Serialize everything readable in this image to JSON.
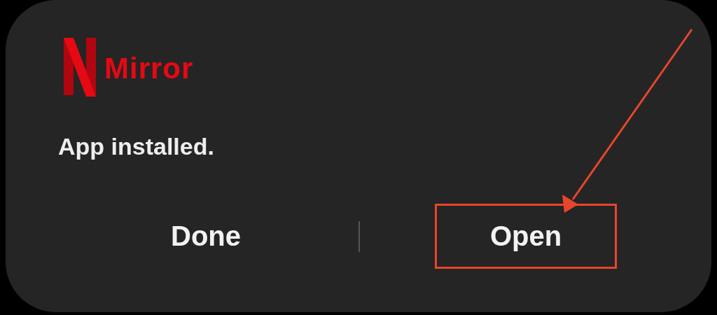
{
  "app": {
    "name": "Mirror"
  },
  "message": "App installed.",
  "buttons": [
    {
      "label": "Done",
      "highlighted": false
    },
    {
      "label": "Open",
      "highlighted": true
    }
  ]
}
